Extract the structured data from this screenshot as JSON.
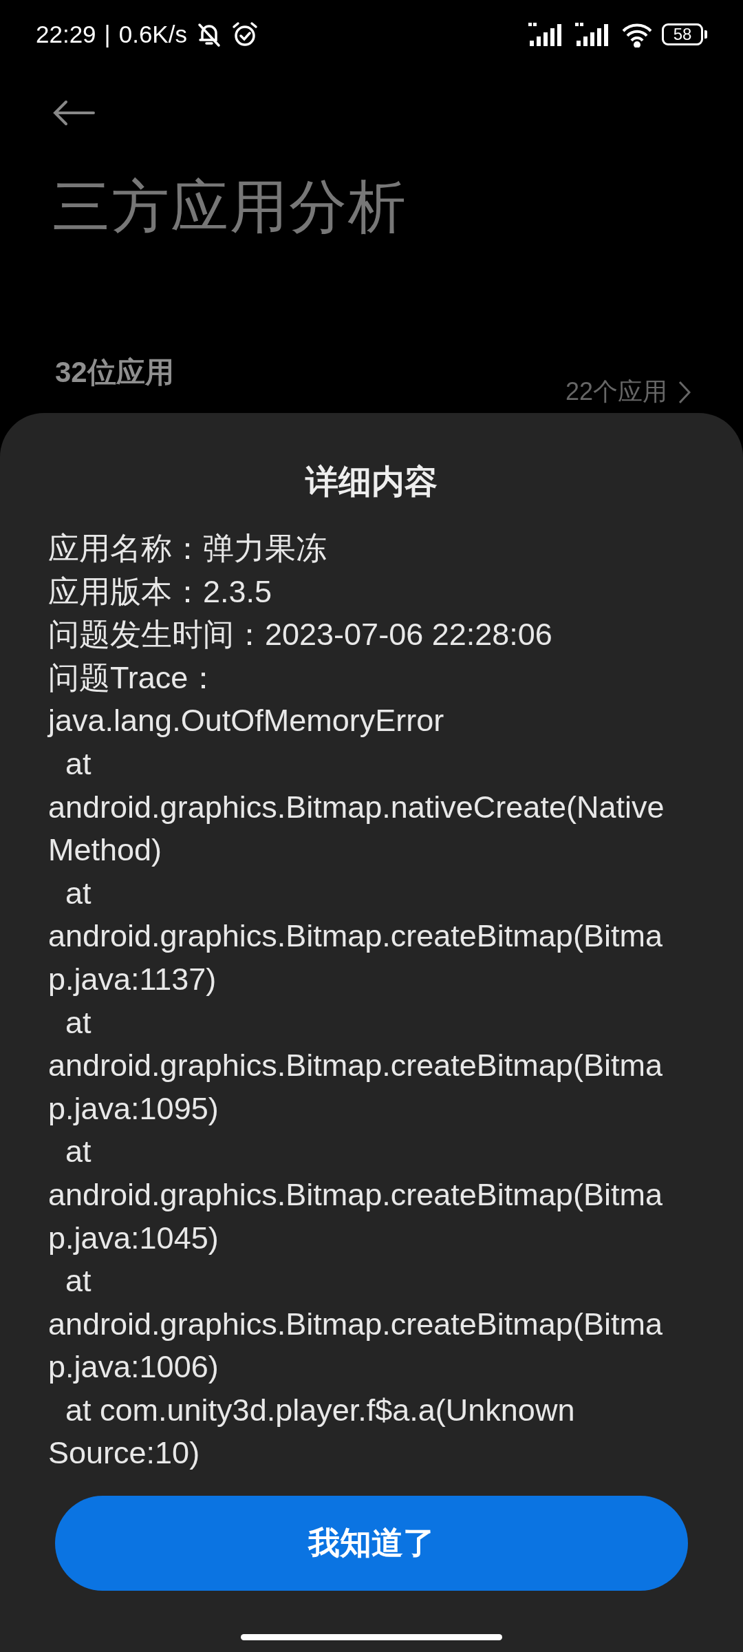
{
  "status_bar": {
    "time": "22:29",
    "divider": "|",
    "speed": "0.6K/s",
    "battery": "58"
  },
  "page": {
    "title": "三方应用分析",
    "section": {
      "title": "32位应用",
      "count": "22个应用"
    }
  },
  "sheet": {
    "title": "详细内容",
    "lines": [
      "应用名称：弹力果冻",
      "应用版本：2.3.5",
      "问题发生时间：2023-07-06 22:28:06",
      "问题Trace：",
      "java.lang.OutOfMemoryError",
      "  at",
      "android.graphics.Bitmap.nativeCreate(Native",
      "Method)",
      "  at",
      "android.graphics.Bitmap.createBitmap(Bitma",
      "p.java:1137)",
      "  at",
      "android.graphics.Bitmap.createBitmap(Bitma",
      "p.java:1095)",
      "  at",
      "android.graphics.Bitmap.createBitmap(Bitma",
      "p.java:1045)",
      "  at",
      "android.graphics.Bitmap.createBitmap(Bitma",
      "p.java:1006)",
      "  at com.unity3d.player.f$a.a(Unknown",
      "Source:10)"
    ],
    "button": "我知道了"
  }
}
